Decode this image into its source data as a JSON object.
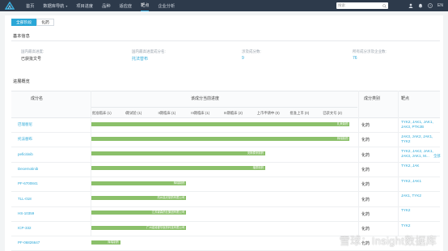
{
  "nav": {
    "items": [
      {
        "label": "首页",
        "caret": false,
        "active": false
      },
      {
        "label": "数据库导航",
        "caret": true,
        "active": false
      },
      {
        "label": "项目进度",
        "caret": false,
        "active": false
      },
      {
        "label": "品种",
        "caret": false,
        "active": false
      },
      {
        "label": "适应症",
        "caret": false,
        "active": false
      },
      {
        "label": "靶点",
        "caret": false,
        "active": true
      },
      {
        "label": "企业分析",
        "caret": false,
        "active": false
      }
    ],
    "search_placeholder": "搜索",
    "lang": "EN"
  },
  "tabs": {
    "all": "全部阶段",
    "chem": "化药"
  },
  "basic": {
    "title": "基本信息",
    "fields": [
      {
        "label": "国内最高进度:",
        "value": "已获批文号",
        "link": false
      },
      {
        "label": "国内最高进度成分名:",
        "value": "托法替布",
        "link": true
      },
      {
        "label": "涉及成分数:",
        "value": "9",
        "link": true
      },
      {
        "label": "所有成分涉及企业数:",
        "value": "76",
        "link": true
      }
    ]
  },
  "progress": {
    "title": "进展概览",
    "col_component": "成分名",
    "col_progress": "该成分当前进度",
    "col_type": "成分类别",
    "col_target": "靶点",
    "phases": [
      "批准临床 (1)",
      "I期试验 (1)",
      "II期临床 (1)",
      "III期临床 (1)",
      "III期临床 (2)",
      "上市申请中 (0)",
      "批准上市 (0)",
      "已获文号 (2)"
    ],
    "rows": [
      {
        "name": "巴瑞替尼",
        "bar_end": 0.98,
        "bar_label": "礼来制药",
        "type": "化药",
        "targets": "TYK2, JAK1, JAK1, JAK3, PTK2B",
        "expand": ""
      },
      {
        "name": "托法替布",
        "bar_end": 0.98,
        "bar_label": "辉瑞制药",
        "type": "化药",
        "targets": "JAK3, JAK2, JAK1, TYK2",
        "expand": ""
      },
      {
        "name": "peficitinib",
        "bar_end": 0.66,
        "bar_label": "安斯泰来制药",
        "type": "化药",
        "targets": "TYK2, JAK2, JAK1, JAK3, JAK1, M...",
        "expand": "全部"
      },
      {
        "name": "Decernotinib",
        "bar_end": 0.66,
        "bar_label": "福泰制药",
        "type": "化药",
        "targets": "TYK2, JAK",
        "expand": ""
      },
      {
        "name": "PF-6700841",
        "bar_end": 0.36,
        "bar_label": "辉瑞制药",
        "type": "化药",
        "targets": "TYK2, JAK1",
        "expand": ""
      },
      {
        "name": "TLL-018",
        "bar_end": 0.36,
        "bar_label": "杭州高光制药有限公司",
        "type": "化药",
        "targets": "JAK1, TYK2",
        "expand": ""
      },
      {
        "name": "HS-10359",
        "bar_end": 0.36,
        "bar_label": "江苏豪森药业集团有限公司",
        "type": "化药",
        "targets": "TYK2",
        "expand": ""
      },
      {
        "name": "ICP-332",
        "bar_end": 0.36,
        "bar_label": "广州诺诚健华医药科技有限公司",
        "type": "化药",
        "targets": "TYK2",
        "expand": ""
      },
      {
        "name": "PF-06826647",
        "bar_end": 0.11,
        "bar_label": "辉瑞制药",
        "type": "化药",
        "targets": "",
        "expand": ""
      }
    ]
  },
  "watermark": "雪球：Insight数据库",
  "colors": {
    "nav_bg": "#2d3a4b",
    "accent": "#2aa7d7",
    "bar": "#8bc06a"
  }
}
